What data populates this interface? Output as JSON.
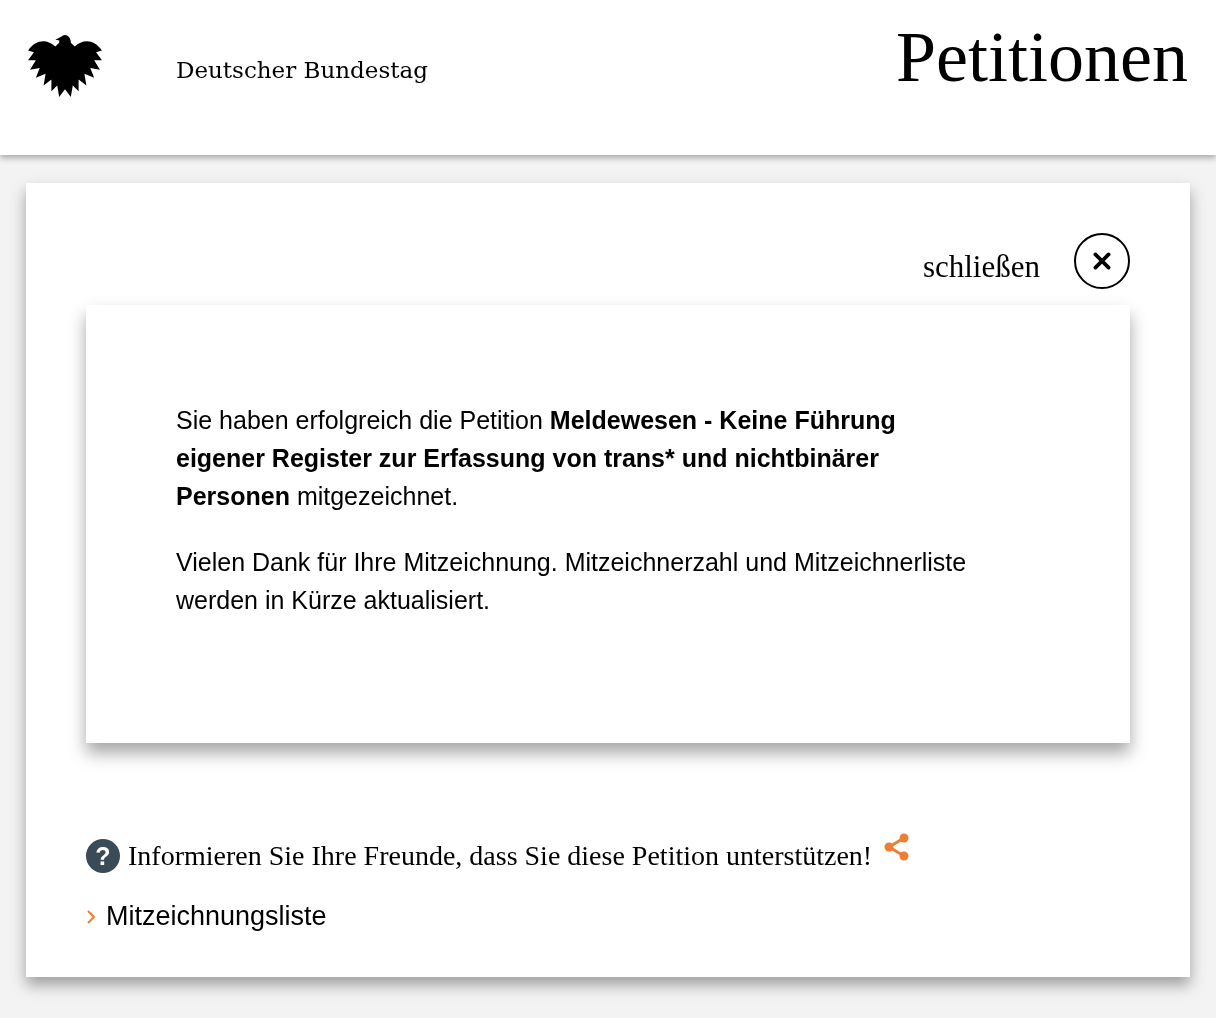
{
  "header": {
    "organization": "Deutscher Bundestag",
    "title": "Petitionen"
  },
  "dialog": {
    "close_label": "schließen",
    "paragraphs": [
      "Sie haben erfolgreich die Petition **Meldewesen - Keine Führung eigener Register zur Erfassung von trans* und nichtbinärer Personen** mitgezeichnet.",
      "Vielen Dank für Ihre Mitzeichnung. Mitzeichnerzahl und Mitzeichnerliste werden in Kürze aktualisiert."
    ]
  },
  "share": {
    "help_mark": "?",
    "text": "Informieren Sie Ihre Freunde, dass Sie diese Petition unterstützen!"
  },
  "links": [
    {
      "label": "Mitzeichnungsliste"
    }
  ]
}
